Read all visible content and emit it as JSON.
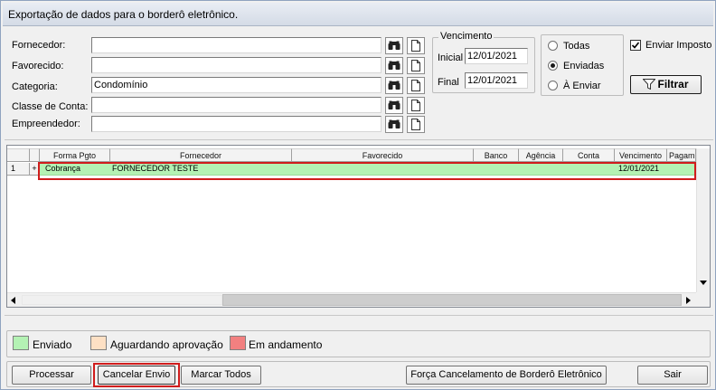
{
  "window": {
    "title": "Exportação de dados para o borderô eletrônico."
  },
  "filters": {
    "fornecedor": {
      "label": "Fornecedor:",
      "value": ""
    },
    "favorecido": {
      "label": "Favorecido:",
      "value": ""
    },
    "categoria": {
      "label": "Categoria:",
      "value": "Condomínio"
    },
    "classe_conta": {
      "label": "Classe de Conta:",
      "value": ""
    },
    "empreendedor": {
      "label": "Empreendedor:",
      "value": ""
    }
  },
  "vencimento": {
    "caption": "Vencimento",
    "inicial_label": "Inicial",
    "inicial_value": "12/01/2021",
    "final_label": "Final",
    "final_value": "12/01/2021"
  },
  "status_filter": {
    "options": [
      "Todas",
      "Enviadas",
      "À Enviar"
    ],
    "selected": "Enviadas"
  },
  "enviar_imposto": {
    "label": "Enviar Imposto",
    "checked": true
  },
  "filter_button": {
    "label": "Filtrar"
  },
  "grid": {
    "columns": [
      "Forma Pgto",
      "Fornecedor",
      "Favorecido",
      "Banco",
      "Agência",
      "Conta",
      "Vencimento",
      "Pagam"
    ],
    "rows": [
      {
        "index": "1",
        "expand": "+",
        "forma_pgto": "Cobrança",
        "fornecedor": "FORNECEDOR TESTE",
        "favorecido": "",
        "banco": "",
        "agencia": "",
        "conta": "",
        "vencimento": "12/01/2021",
        "pagamento": ""
      }
    ]
  },
  "legend": {
    "enviado": {
      "label": "Enviado",
      "color": "#b4f2b4"
    },
    "aguardando": {
      "label": "Aguardando aprovação",
      "color": "#fde0c4"
    },
    "andamento": {
      "label": "Em andamento",
      "color": "#f28080"
    }
  },
  "actions": {
    "processar": "Processar",
    "cancelar_envio": "Cancelar Envio",
    "marcar_todos": "Marcar Todos",
    "forca_cancelamento": "Força Cancelamento de Borderô Eletrônico",
    "sair": "Sair"
  }
}
